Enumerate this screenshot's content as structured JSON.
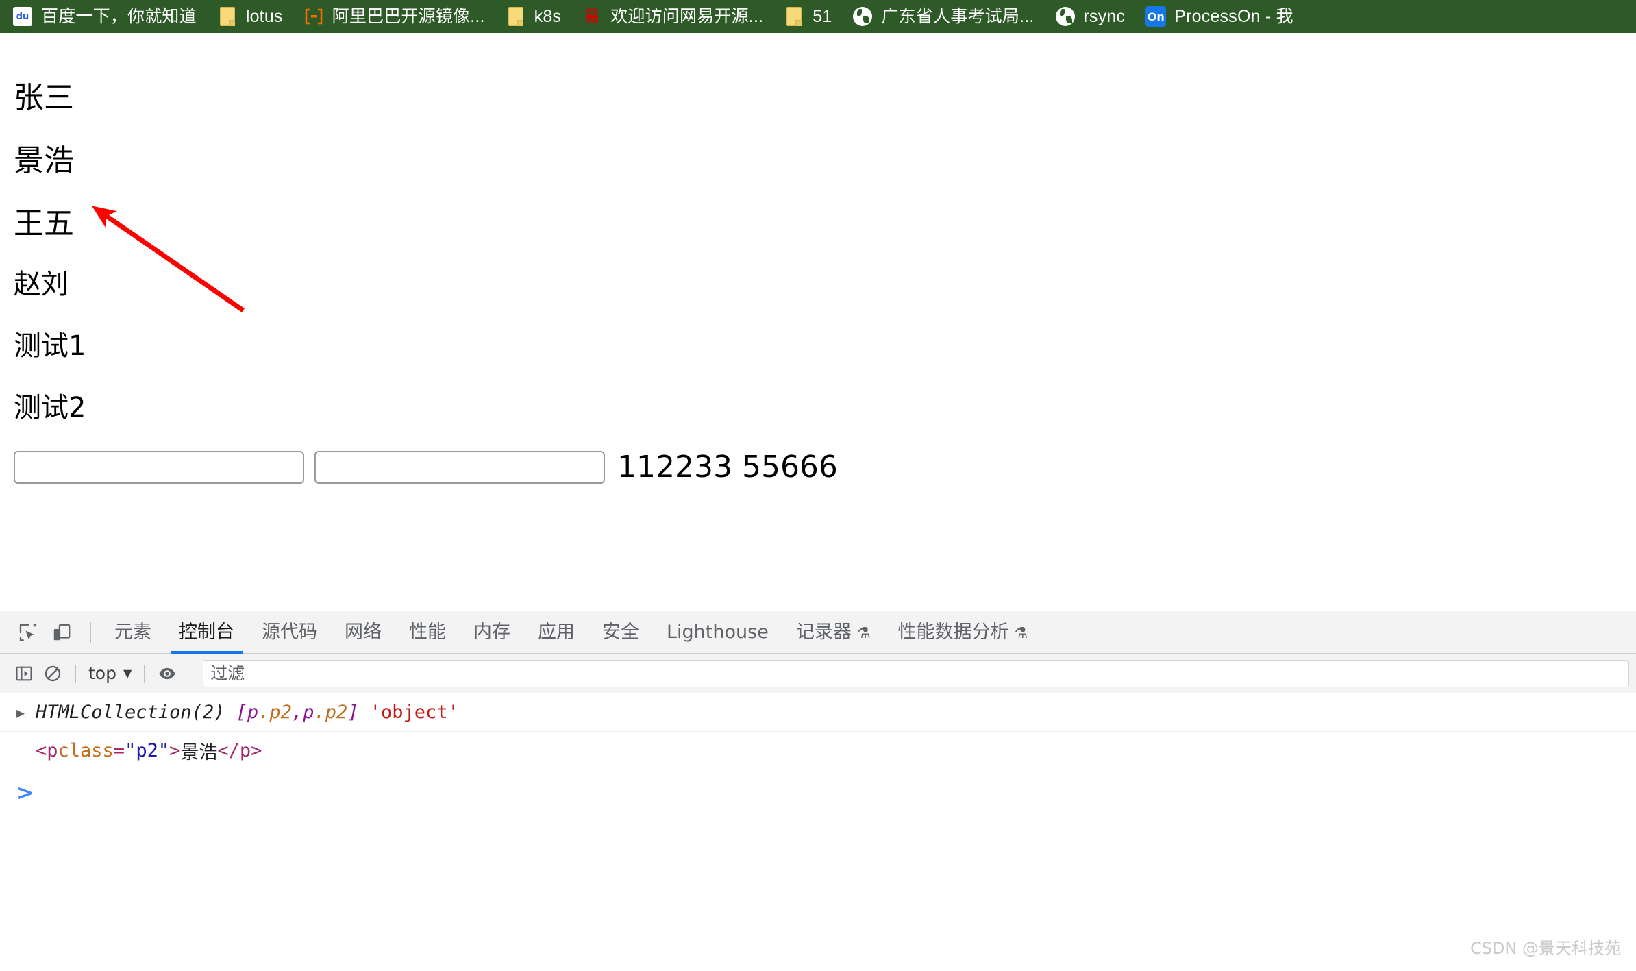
{
  "browser": {
    "bookmarks": [
      {
        "label": "百度一下，你就知道",
        "icon": "baidu-icon"
      },
      {
        "label": "lotus",
        "icon": "folder-icon"
      },
      {
        "label": "阿里巴巴开源镜像...",
        "icon": "aliyun-icon"
      },
      {
        "label": "k8s",
        "icon": "folder-icon"
      },
      {
        "label": "欢迎访问网易开源...",
        "icon": "netease-icon"
      },
      {
        "label": "51",
        "icon": "folder-icon"
      },
      {
        "label": "广东省人事考试局...",
        "icon": "globe-icon"
      },
      {
        "label": "rsync",
        "icon": "globe-icon"
      },
      {
        "label": "ProcessOn - 我",
        "icon": "processon-icon"
      }
    ],
    "bar_color": "#2d5a27"
  },
  "page": {
    "names": [
      {
        "text": "张三",
        "size": "big"
      },
      {
        "text": "景浩",
        "size": "big"
      },
      {
        "text": "王五",
        "size": "big"
      },
      {
        "text": "赵刘",
        "size": "small"
      },
      {
        "text": "测试1",
        "size": "small"
      },
      {
        "text": "测试2",
        "size": "small"
      }
    ],
    "inputs": [
      {
        "value": "",
        "placeholder": ""
      },
      {
        "value": "",
        "placeholder": ""
      }
    ],
    "trailing_text": "112233 55666",
    "annotation": {
      "type": "arrow",
      "color": "#ff0000",
      "points_to": "景浩"
    }
  },
  "devtools": {
    "tabs": [
      {
        "label": "元素",
        "active": false,
        "experimental": false
      },
      {
        "label": "控制台",
        "active": true,
        "experimental": false
      },
      {
        "label": "源代码",
        "active": false,
        "experimental": false
      },
      {
        "label": "网络",
        "active": false,
        "experimental": false
      },
      {
        "label": "性能",
        "active": false,
        "experimental": false
      },
      {
        "label": "内存",
        "active": false,
        "experimental": false
      },
      {
        "label": "应用",
        "active": false,
        "experimental": false
      },
      {
        "label": "安全",
        "active": false,
        "experimental": false
      },
      {
        "label": "Lighthouse",
        "active": false,
        "experimental": false
      },
      {
        "label": "记录器",
        "active": false,
        "experimental": true
      },
      {
        "label": "性能数据分析",
        "active": false,
        "experimental": true
      }
    ],
    "active_tab_underline_color": "#1a73e8",
    "toolbar_icons": [
      "inspect-element-icon",
      "device-toolbar-icon"
    ],
    "filterbar": {
      "sidebar_icon": "console-sidebar-icon",
      "clear_icon": "clear-console-icon",
      "context": "top",
      "context_caret": "▼",
      "eye_icon": "live-expression-icon",
      "filter_placeholder": "过滤",
      "filter_value": ""
    },
    "console": {
      "rows": [
        {
          "type": "object-result",
          "disclosure": "▶",
          "tokens": [
            {
              "t": "HTMLCollection(2)",
              "cls": "default-italic"
            },
            {
              "t": " ",
              "cls": "space"
            },
            {
              "t": "[",
              "cls": "prop"
            },
            {
              "t": "p",
              "cls": "prop"
            },
            {
              "t": ".p2",
              "cls": "num"
            },
            {
              "t": ", ",
              "cls": "prop"
            },
            {
              "t": "p",
              "cls": "prop"
            },
            {
              "t": ".p2",
              "cls": "num"
            },
            {
              "t": "]",
              "cls": "prop"
            },
            {
              "t": " ",
              "cls": "space"
            },
            {
              "t": "'object'",
              "cls": "string"
            }
          ]
        },
        {
          "type": "html-result",
          "disclosure": "",
          "tokens": [
            {
              "t": "<p",
              "cls": "tag"
            },
            {
              "t": " class",
              "cls": "attr"
            },
            {
              "t": "=",
              "cls": "tag"
            },
            {
              "t": "\"p2\"",
              "cls": "val"
            },
            {
              "t": ">",
              "cls": "tag"
            },
            {
              "t": "景浩",
              "cls": "text"
            },
            {
              "t": "</p>",
              "cls": "tag"
            }
          ]
        }
      ],
      "prompt_chevron": ">",
      "prompt_value": "",
      "prompt_color": "#4285f4"
    }
  },
  "watermark": "CSDN @景天科技苑"
}
